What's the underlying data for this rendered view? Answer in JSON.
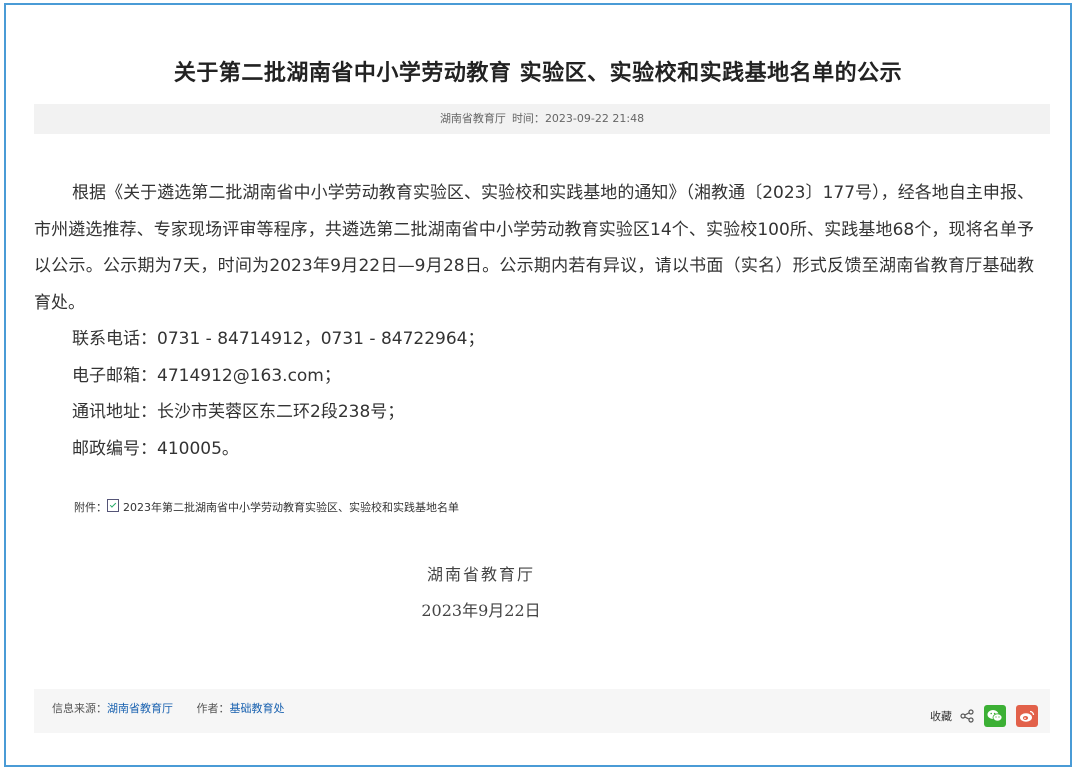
{
  "article": {
    "title": "关于第二批湖南省中小学劳动教育 实验区、实验校和实践基地名单的公示",
    "meta": {
      "publisher": "湖南省教育厅",
      "time_label": "时间：",
      "time": "2023-09-22 21:48"
    },
    "body": {
      "paragraph": "根据《关于遴选第二批湖南省中小学劳动教育实验区、实验校和实践基地的通知》（湘教通〔2023〕177号），经各地自主申报、市州遴选推荐、专家现场评审等程序，共遴选第二批湖南省中小学劳动教育实验区14个、实验校100所、实践基地68个，现将名单予以公示。公示期为7天，时间为2023年9月22日—9月28日。公示期内若有异议，请以书面（实名）形式反馈至湖南省教育厅基础教育处。",
      "phone": "联系电话：0731 - 84714912，0731 - 84722964；",
      "email": "电子邮箱：4714912@163.com；",
      "address": "通讯地址：长沙市芙蓉区东二环2段238号；",
      "postcode": "邮政编号：410005。"
    },
    "attachment": {
      "label": "附件：",
      "file": "2023年第二批湖南省中小学劳动教育实验区、实验校和实践基地名单"
    },
    "signature": {
      "org": "湖南省教育厅",
      "date": "2023年9月22日"
    },
    "footer": {
      "source_label": "信息来源：",
      "source": "湖南省教育厅",
      "author_label": "作者：",
      "author": "基础教育处",
      "favorite": "收藏"
    }
  },
  "colors": {
    "frame_border": "#4a9bd6",
    "link": "#1a62b0",
    "wechat": "#3cb035",
    "weibo": "#e2614a"
  },
  "icons": [
    "document-icon",
    "share-icon",
    "wechat-icon",
    "weibo-icon"
  ]
}
